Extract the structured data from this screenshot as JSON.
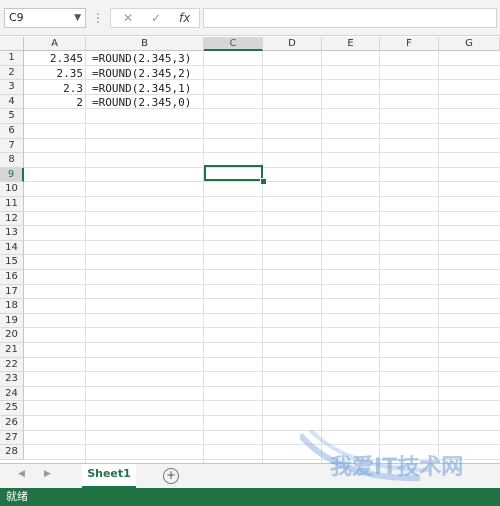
{
  "formula_bar": {
    "name_box": "C9",
    "cancel_icon": "✕",
    "enter_icon": "✓",
    "fx_label": "fx",
    "formula_value": ""
  },
  "columns": [
    "A",
    "B",
    "C",
    "D",
    "E",
    "F",
    "G"
  ],
  "selected_column": "C",
  "rows": [
    "1",
    "2",
    "3",
    "4",
    "5",
    "6",
    "7",
    "8",
    "9",
    "10",
    "11",
    "12",
    "13",
    "14",
    "15",
    "16",
    "17",
    "18",
    "19",
    "20",
    "21",
    "22",
    "23",
    "24",
    "25",
    "26",
    "27",
    "28"
  ],
  "selected_row": "9",
  "cells": [
    {
      "a": "2.345",
      "b": "=ROUND(2.345,3)"
    },
    {
      "a": "2.35",
      "b": "=ROUND(2.345,2)"
    },
    {
      "a": "2.3",
      "b": "=ROUND(2.345,1)"
    },
    {
      "a": "2",
      "b": "=ROUND(2.345,0)"
    }
  ],
  "tabs": {
    "sheet1": "Sheet1",
    "add": "+"
  },
  "status": {
    "ready": "就绪"
  },
  "watermark": {
    "text": "我爱IT技术网"
  },
  "colors": {
    "accent": "#217346",
    "header_bg": "#f3f3f3"
  }
}
